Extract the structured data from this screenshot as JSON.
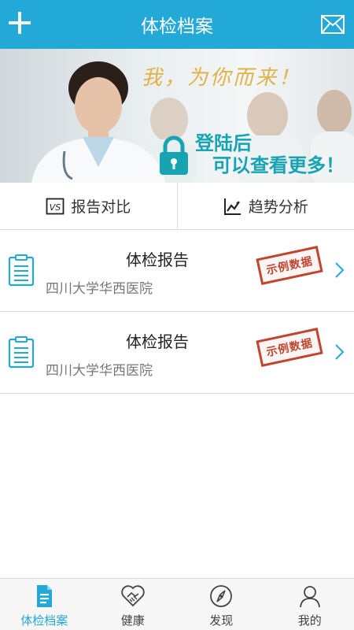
{
  "header": {
    "title": "体检档案"
  },
  "banner": {
    "slogan": "我，为你而来！",
    "login_line1": "登陆后",
    "login_line2": "可以查看更多！"
  },
  "actions": {
    "compare_label": "报告对比",
    "compare_icon_text": "VS",
    "trend_label": "趋势分析"
  },
  "reports": [
    {
      "title": "体检报告",
      "hospital": "四川大学华西医院",
      "stamp": "示例数据"
    },
    {
      "title": "体检报告",
      "hospital": "四川大学华西医院",
      "stamp": "示例数据"
    }
  ],
  "tabs": [
    {
      "label": "体检档案",
      "icon": "document-icon",
      "active": true
    },
    {
      "label": "健康",
      "icon": "handshake-icon"
    },
    {
      "label": "发现",
      "icon": "compass-icon"
    },
    {
      "label": "我的",
      "icon": "user-icon"
    }
  ],
  "colors": {
    "primary": "#23a9d8",
    "stamp": "#c0442e",
    "login_text": "#16a3b2"
  }
}
